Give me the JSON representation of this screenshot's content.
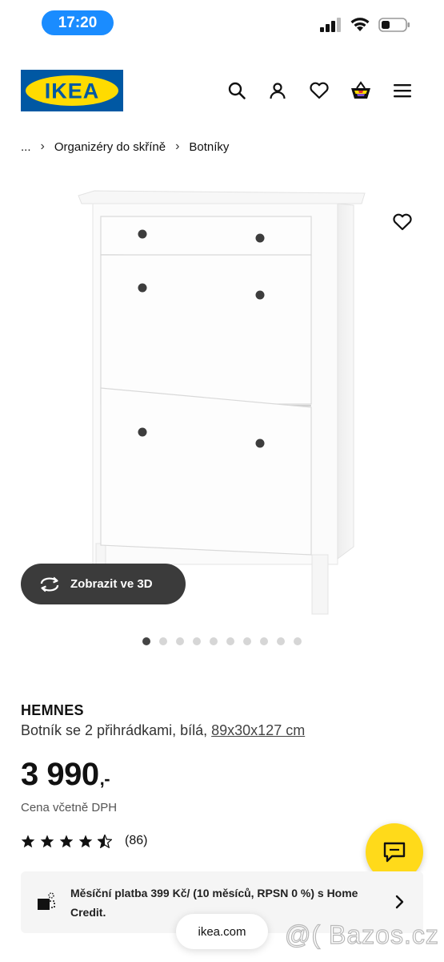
{
  "status_bar": {
    "time": "17:20"
  },
  "brand": {
    "logo_text": "IKEA",
    "logo_blue": "#0058a3",
    "logo_yellow": "#ffdb00"
  },
  "header": {
    "icons": [
      "search-icon",
      "user-icon",
      "heart-icon",
      "basket-icon",
      "menu-icon"
    ]
  },
  "breadcrumb": {
    "items": [
      "...",
      "Organizéry do skříně",
      "Botníky"
    ],
    "separator": "›"
  },
  "gallery": {
    "view3d_label": "Zobrazit ve 3D",
    "image_count": 10,
    "active_index": 0
  },
  "product": {
    "name": "HEMNES",
    "description": "Botník se 2 přihrádkami, bílá, ",
    "size": "89x30x127 cm",
    "price": "3 990",
    "price_suffix": ",-",
    "vat_note": "Cena včetně DPH",
    "rating": 4.5,
    "rating_count": "(86)"
  },
  "credit": {
    "text": "Měsíční platba 399 Kč/ (10 měsíců, RPSN 0 %) s Home Credit."
  },
  "browser": {
    "url": "ikea.com"
  },
  "watermark": {
    "text": "@( Bazos.cz"
  },
  "colors": {
    "chat_fab": "#ffda1a",
    "view3d_bg": "#3b3b3b",
    "time_pill": "#1a8cff"
  }
}
